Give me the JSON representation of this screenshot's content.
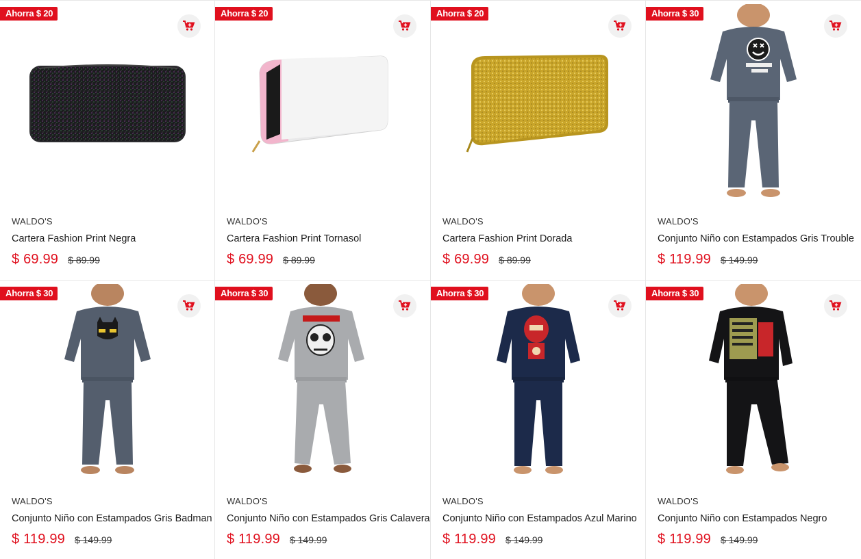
{
  "products": [
    {
      "badge": "Ahorra $ 20",
      "brand": "WALDO'S",
      "title": "Cartera Fashion Print Negra",
      "price": "$ 69.99",
      "old_price": "$ 89.99",
      "image": "wallet-black"
    },
    {
      "badge": "Ahorra $ 20",
      "brand": "WALDO'S",
      "title": "Cartera Fashion Print Tornasol",
      "price": "$ 69.99",
      "old_price": "$ 89.99",
      "image": "wallet-silver"
    },
    {
      "badge": "Ahorra $ 20",
      "brand": "WALDO'S",
      "title": "Cartera Fashion Print Dorada",
      "price": "$ 69.99",
      "old_price": "$ 89.99",
      "image": "wallet-gold"
    },
    {
      "badge": "Ahorra $ 30",
      "brand": "WALDO'S",
      "title": "Conjunto Niño con Estampados Gris Trouble",
      "price": "$ 119.99",
      "old_price": "$ 149.99",
      "image": "kid-gray-trouble"
    },
    {
      "badge": "Ahorra $ 30",
      "brand": "WALDO'S",
      "title": "Conjunto Niño con Estampados Gris Badman",
      "price": "$ 119.99",
      "old_price": "$ 149.99",
      "image": "kid-gray-badman"
    },
    {
      "badge": "Ahorra $ 30",
      "brand": "WALDO'S",
      "title": "Conjunto Niño con Estampados Gris Calavera",
      "price": "$ 119.99",
      "old_price": "$ 149.99",
      "image": "kid-light-gray-skull"
    },
    {
      "badge": "Ahorra $ 30",
      "brand": "WALDO'S",
      "title": "Conjunto Niño con Estampados Azul Marino",
      "price": "$ 119.99",
      "old_price": "$ 149.99",
      "image": "kid-navy"
    },
    {
      "badge": "Ahorra $ 30",
      "brand": "WALDO'S",
      "title": "Conjunto Niño con Estampados Negro",
      "price": "$ 119.99",
      "old_price": "$ 149.99",
      "image": "kid-black-ninja"
    }
  ],
  "icons": {
    "cart": "add-to-cart-icon"
  },
  "colors": {
    "accent": "#e0101e",
    "badge_text": "#ffffff",
    "cart_bg": "#f1f1f1"
  }
}
